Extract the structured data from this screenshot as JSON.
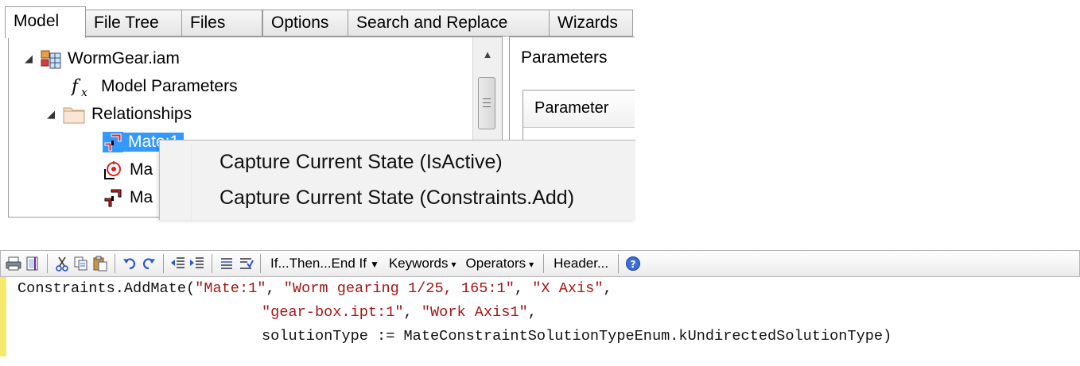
{
  "tabs": [
    "Model",
    "File Tree",
    "Files",
    "Options",
    "Search and Replace",
    "Wizards"
  ],
  "tree": {
    "root": "WormGear.iam",
    "model_parameters": "Model Parameters",
    "relationships": "Relationships",
    "items": [
      "Mate:1",
      "Ma",
      "Ma"
    ]
  },
  "params_panel": {
    "title": "Parameters",
    "column_header": "Parameter"
  },
  "context_menu": {
    "items": [
      "Capture Current State (IsActive)",
      "Capture Current State (Constraints.Add)"
    ]
  },
  "toolbar": {
    "if_then": "If...Then...End If",
    "keywords": "Keywords",
    "operators": "Operators",
    "header": "Header..."
  },
  "code": {
    "line1_prefix": "Constraints.AddMate(",
    "line1_arg1": "\"Mate:1\"",
    "line1_arg2": "\"Worm gearing 1/25, 165:1\"",
    "line1_arg3": "\"X Axis\"",
    "line2_arg1": "\"gear-box.ipt:1\"",
    "line2_arg2": "\"Work Axis1\"",
    "line3": "solutionType := MateConstraintSolutionTypeEnum.kUndirectedSolutionType)"
  },
  "colors": {
    "selection": "#3399ff",
    "string": "#a31515",
    "gutter": "#f5ea6b"
  }
}
